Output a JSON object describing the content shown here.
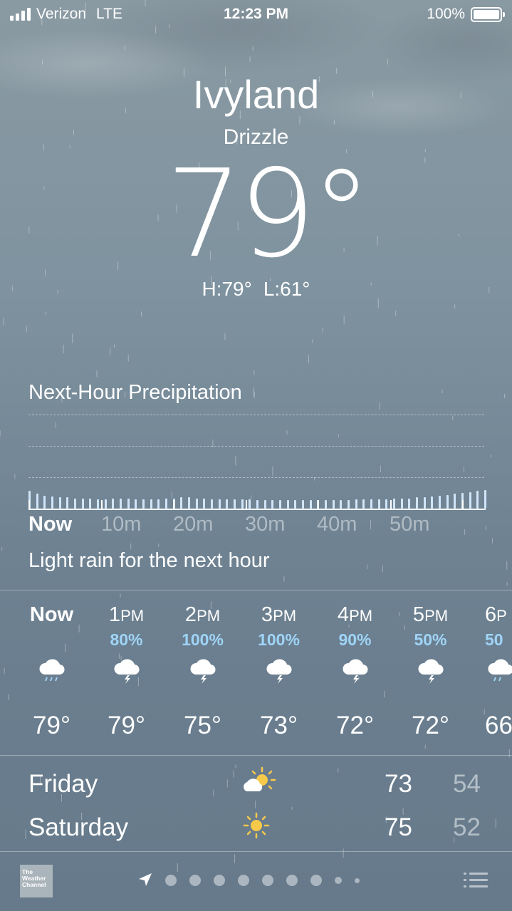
{
  "status_bar": {
    "carrier": "Verizon",
    "network": "LTE",
    "time": "12:23 PM",
    "battery": "100%"
  },
  "location": {
    "city": "Ivyland",
    "condition": "Drizzle",
    "temperature": "79°",
    "high": "H:79°",
    "low": "L:61°"
  },
  "precipitation": {
    "title": "Next-Hour Precipitation",
    "time_labels": [
      "Now",
      "10m",
      "20m",
      "30m",
      "40m",
      "50m"
    ],
    "summary": "Light rain for the next hour",
    "intensity": [
      0.95,
      0.8,
      0.7,
      0.65,
      0.6,
      0.6,
      0.55,
      0.55,
      0.55,
      0.5,
      0.5,
      0.55,
      0.55,
      0.55,
      0.5,
      0.5,
      0.5,
      0.5,
      0.55,
      0.55,
      0.6,
      0.6,
      0.55,
      0.55,
      0.5,
      0.5,
      0.5,
      0.5,
      0.5,
      0.5,
      0.45,
      0.45,
      0.45,
      0.45,
      0.45,
      0.45,
      0.45,
      0.45,
      0.45,
      0.45,
      0.45,
      0.45,
      0.45,
      0.5,
      0.5,
      0.5,
      0.5,
      0.5,
      0.55,
      0.55,
      0.55,
      0.6,
      0.6,
      0.65,
      0.7,
      0.75,
      0.8,
      0.85,
      0.9,
      0.95,
      1.0
    ]
  },
  "hourly": [
    {
      "time": "Now",
      "pct": "",
      "icon": "cloud-rain-icon",
      "temp": "79°"
    },
    {
      "time_num": "1",
      "time_suffix": "PM",
      "pct": "80%",
      "icon": "cloud-lightning-icon",
      "temp": "79°"
    },
    {
      "time_num": "2",
      "time_suffix": "PM",
      "pct": "100%",
      "icon": "cloud-lightning-icon",
      "temp": "75°"
    },
    {
      "time_num": "3",
      "time_suffix": "PM",
      "pct": "100%",
      "icon": "cloud-lightning-icon",
      "temp": "73°"
    },
    {
      "time_num": "4",
      "time_suffix": "PM",
      "pct": "90%",
      "icon": "cloud-lightning-icon",
      "temp": "72°"
    },
    {
      "time_num": "5",
      "time_suffix": "PM",
      "pct": "50%",
      "icon": "cloud-lightning-icon",
      "temp": "72°"
    },
    {
      "time_num": "6",
      "time_suffix": "P",
      "pct": "50",
      "icon": "cloud-rain-icon",
      "temp": "66"
    }
  ],
  "daily": [
    {
      "day": "Friday",
      "icon": "partly-sunny-icon",
      "high": "73",
      "low": "54"
    },
    {
      "day": "Saturday",
      "icon": "sun-icon",
      "high": "75",
      "low": "52"
    }
  ],
  "bottom_bar": {
    "logo_text": [
      "The",
      "Weather",
      "Channel"
    ]
  },
  "colors": {
    "precip_bar": "#cfe6fb",
    "percent_text": "#9fd4f6",
    "sun": "#f7c94a"
  }
}
